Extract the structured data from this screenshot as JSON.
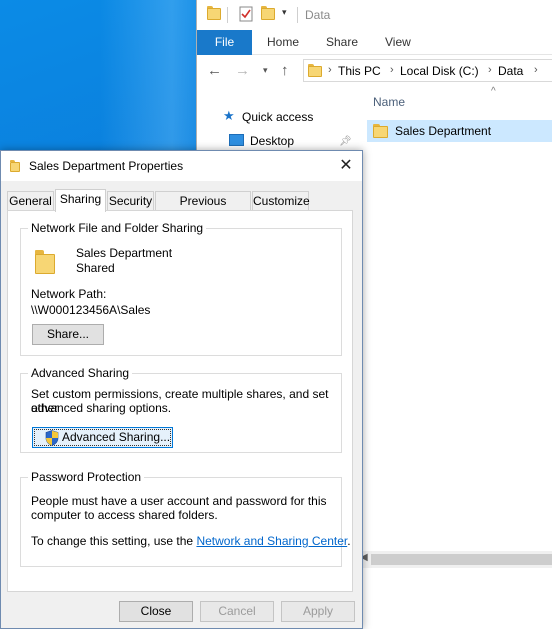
{
  "explorer": {
    "window_title": "Data",
    "ribbon_tabs": [
      "File",
      "Home",
      "Share",
      "View"
    ],
    "breadcrumb": [
      "This PC",
      "Local Disk (C:)",
      "Data"
    ],
    "nav_items": [
      "Quick access",
      "Desktop"
    ],
    "column_header": "Name",
    "files": [
      {
        "name": "Sales Department",
        "selected": true
      }
    ]
  },
  "dialog": {
    "title": "Sales Department Properties",
    "close_label": "✕",
    "tabs": [
      "General",
      "Sharing",
      "Security",
      "Previous Versions",
      "Customize"
    ],
    "active_tab": "Sharing",
    "network_sharing": {
      "heading": "Network File and Folder Sharing",
      "folder_name": "Sales Department",
      "status": "Shared",
      "path_label": "Network Path:",
      "path_value": "\\\\W000123456A\\Sales",
      "share_button": "Share..."
    },
    "advanced_sharing": {
      "heading": "Advanced Sharing",
      "description_line1": "Set custom permissions, create multiple shares, and set other",
      "description_line2": "advanced sharing options.",
      "button": "Advanced Sharing..."
    },
    "password_protection": {
      "heading": "Password Protection",
      "line1": "People must have a user account and password for this",
      "line2": "computer to access shared folders.",
      "change_prefix": "To change this setting, use the ",
      "link": "Network and Sharing Center",
      "change_suffix": "."
    },
    "buttons": {
      "close": "Close",
      "cancel": "Cancel",
      "apply": "Apply"
    }
  },
  "colors": {
    "accent": "#1979ca",
    "selection": "#cce8ff",
    "link": "#0066cc",
    "folder": "#f7d674"
  },
  "icons": [
    "folder-icon",
    "properties-icon",
    "back-arrow-icon",
    "forward-arrow-icon",
    "up-arrow-icon",
    "star-icon",
    "desktop-icon",
    "pin-icon",
    "shield-icon",
    "close-icon"
  ]
}
